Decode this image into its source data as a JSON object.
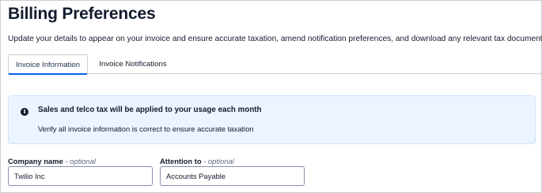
{
  "page": {
    "title": "Billing Preferences",
    "description": "Update your details to appear on your invoice and ensure accurate taxation, amend notification preferences, and download any relevant tax documents."
  },
  "tabs": [
    {
      "label": "Invoice Information",
      "active": true
    },
    {
      "label": "Invoice Notifications",
      "active": false
    }
  ],
  "callout": {
    "icon": "info-icon",
    "heading": "Sales and telco tax will be applied to your usage each month",
    "body": "Verify all invoice information is correct to ensure accurate taxation"
  },
  "form": {
    "company_name": {
      "label": "Company name",
      "optional_text": "- optional",
      "value": "Twilio Inc"
    },
    "attention_to": {
      "label": "Attention to",
      "optional_text": "- optional",
      "value": "Accounts Payable"
    }
  },
  "colors": {
    "accent": "#0263e0",
    "callout_background": "#ebf4ff",
    "text": "#121c2d",
    "muted_text": "#606b85"
  }
}
